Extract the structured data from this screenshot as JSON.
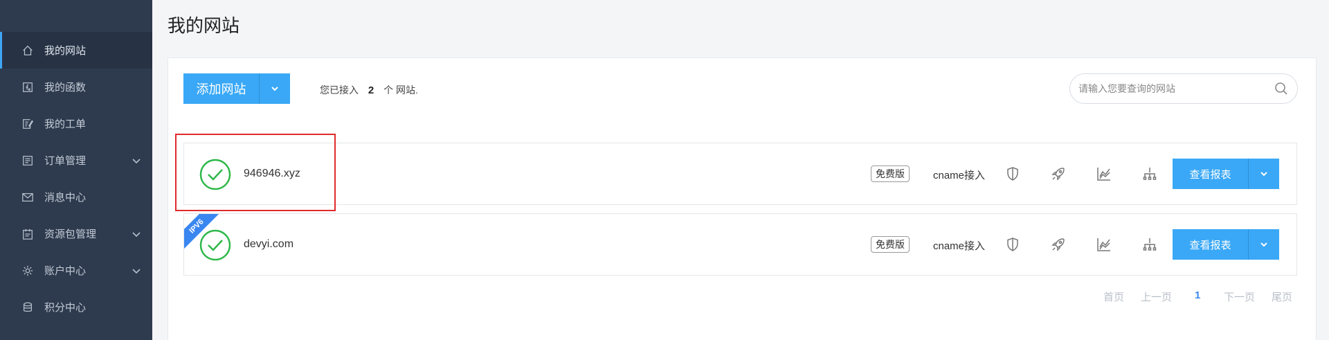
{
  "sidebar": {
    "items": [
      {
        "label": "我的网站",
        "icon": "home-icon",
        "active": true
      },
      {
        "label": "我的函数",
        "icon": "function-icon"
      },
      {
        "label": "我的工单",
        "icon": "ticket-icon"
      },
      {
        "label": "订单管理",
        "icon": "order-icon",
        "expandable": true
      },
      {
        "label": "消息中心",
        "icon": "mail-icon"
      },
      {
        "label": "资源包管理",
        "icon": "package-icon",
        "expandable": true
      },
      {
        "label": "账户中心",
        "icon": "gear-icon",
        "expandable": true
      },
      {
        "label": "积分中心",
        "icon": "database-icon"
      }
    ]
  },
  "page": {
    "title": "我的网站"
  },
  "toolbar": {
    "add_label": "添加网站",
    "summary_prefix": "您已接入",
    "site_count": "2",
    "summary_suffix": "个 网站."
  },
  "search": {
    "placeholder": "请输入您要查询的网站"
  },
  "sites": [
    {
      "domain": "946946.xyz",
      "plan": "免费版",
      "access": "cname接入",
      "report_label": "查看报表",
      "ipv6": false,
      "status": "ok"
    },
    {
      "domain": "devyi.com",
      "plan": "免费版",
      "access": "cname接入",
      "report_label": "查看报表",
      "ipv6": true,
      "ipv6_label": "IPV6",
      "status": "ok"
    }
  ],
  "pagination": {
    "first": "首页",
    "prev": "上一页",
    "current": "1",
    "next": "下一页",
    "last": "尾页"
  },
  "colors": {
    "sidebar_bg": "#2e3b4e",
    "accent": "#3aa8f6",
    "success": "#2fb84a",
    "highlight": "#e02a2a",
    "ipv6_ribbon": "#3a86f0"
  }
}
